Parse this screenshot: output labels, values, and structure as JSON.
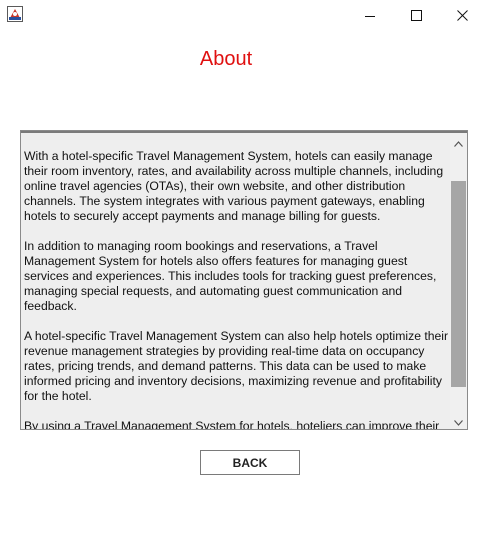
{
  "window": {
    "icon": "java-app-icon",
    "controls": {
      "minimize_icon": "minimize-icon",
      "maximize_icon": "maximize-icon",
      "close_icon": "close-icon"
    }
  },
  "heading": {
    "title": "About",
    "color": "#e01010"
  },
  "about_text": {
    "paragraphs": [
      "With a hotel-specific Travel Management System, hotels can easily manage their room inventory, rates, and availability across multiple channels, including online travel agencies (OTAs), their own website, and other distribution channels. The system integrates with various payment gateways, enabling hotels to securely accept payments and manage billing for guests.",
      "In addition to managing room bookings and reservations, a Travel Management System for hotels also offers features for managing guest services and experiences. This includes tools for tracking guest preferences, managing special requests, and automating guest communication and feedback.",
      "A hotel-specific Travel Management System can also help hotels optimize their revenue management strategies by providing real-time data on occupancy rates, pricing trends, and demand patterns. This data can be used to make informed pricing and inventory decisions, maximizing revenue and profitability for the hotel.",
      "By using a Travel Management System for hotels, hoteliers can improve their"
    ],
    "scroll_position": 0.0
  },
  "footer": {
    "back_label": "BACK"
  }
}
